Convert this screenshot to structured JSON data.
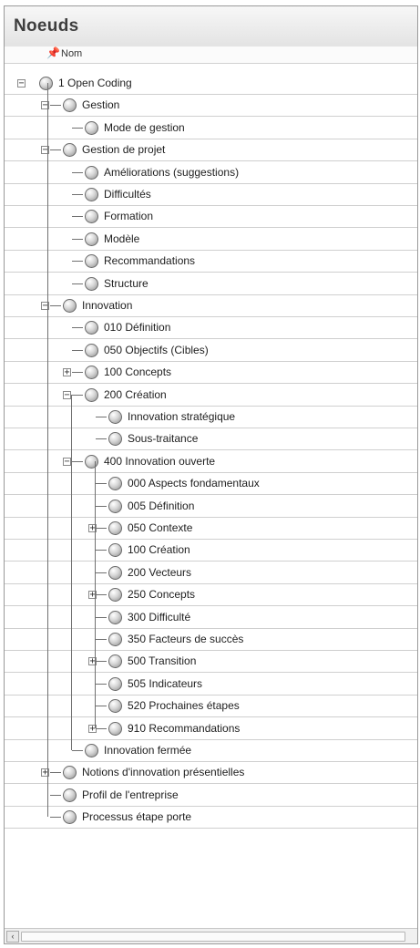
{
  "panel": {
    "title": "Noeuds"
  },
  "header": {
    "column_label": "Nom",
    "pin_icon": "pin-icon"
  },
  "tree": [
    {
      "label": "1 Open Coding",
      "level": 0,
      "toggle": "−"
    },
    {
      "label": "Gestion",
      "level": 1,
      "toggle": "−"
    },
    {
      "label": "Mode de gestion",
      "level": 2,
      "toggle": ""
    },
    {
      "label": "Gestion de projet",
      "level": 1,
      "toggle": "−"
    },
    {
      "label": "Améliorations (suggestions)",
      "level": 2,
      "toggle": ""
    },
    {
      "label": "Difficultés",
      "level": 2,
      "toggle": ""
    },
    {
      "label": "Formation",
      "level": 2,
      "toggle": ""
    },
    {
      "label": "Modèle",
      "level": 2,
      "toggle": ""
    },
    {
      "label": "Recommandations",
      "level": 2,
      "toggle": ""
    },
    {
      "label": "Structure",
      "level": 2,
      "toggle": ""
    },
    {
      "label": "Innovation",
      "level": 1,
      "toggle": "−"
    },
    {
      "label": "010 Définition",
      "level": 2,
      "toggle": ""
    },
    {
      "label": "050 Objectifs (Cibles)",
      "level": 2,
      "toggle": ""
    },
    {
      "label": "100 Concepts",
      "level": 2,
      "toggle": "+"
    },
    {
      "label": "200 Création",
      "level": 2,
      "toggle": "−"
    },
    {
      "label": "Innovation stratégique",
      "level": 3,
      "toggle": ""
    },
    {
      "label": "Sous-traitance",
      "level": 3,
      "toggle": ""
    },
    {
      "label": "400 Innovation ouverte",
      "level": 2,
      "toggle": "−"
    },
    {
      "label": "000 Aspects fondamentaux",
      "level": 3,
      "toggle": ""
    },
    {
      "label": "005 Définition",
      "level": 3,
      "toggle": ""
    },
    {
      "label": "050 Contexte",
      "level": 3,
      "toggle": "+"
    },
    {
      "label": "100 Création",
      "level": 3,
      "toggle": ""
    },
    {
      "label": "200 Vecteurs",
      "level": 3,
      "toggle": ""
    },
    {
      "label": "250 Concepts",
      "level": 3,
      "toggle": "+"
    },
    {
      "label": "300 Difficulté",
      "level": 3,
      "toggle": ""
    },
    {
      "label": "350 Facteurs de succès",
      "level": 3,
      "toggle": ""
    },
    {
      "label": "500 Transition",
      "level": 3,
      "toggle": "+"
    },
    {
      "label": "505 Indicateurs",
      "level": 3,
      "toggle": ""
    },
    {
      "label": "520 Prochaines étapes",
      "level": 3,
      "toggle": ""
    },
    {
      "label": "910 Recommandations",
      "level": 3,
      "toggle": "+"
    },
    {
      "label": "Innovation fermée",
      "level": 2,
      "toggle": ""
    },
    {
      "label": "Notions d'innovation présentielles",
      "level": 1,
      "toggle": "+"
    },
    {
      "label": "Profil de l'entreprise",
      "level": 1,
      "toggle": ""
    },
    {
      "label": "Processus étape porte",
      "level": 1,
      "toggle": ""
    }
  ],
  "scrollbar": {
    "left_arrow": "‹"
  }
}
